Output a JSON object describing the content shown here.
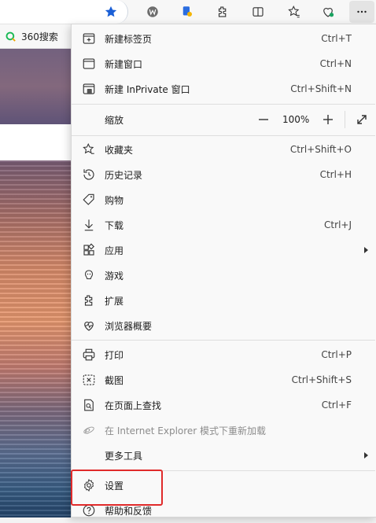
{
  "bookmarks": {
    "items": [
      {
        "label": "360搜索"
      }
    ]
  },
  "toolbar": {
    "icons": [
      "favorite-star-icon",
      "profile-w-icon",
      "extension-puzzle-icon",
      "split-screen-icon",
      "favorites-icon",
      "browser-health-icon",
      "more-icon"
    ]
  },
  "menu": {
    "items": [
      {
        "label": "新建标签页",
        "shortcut": "Ctrl+T"
      },
      {
        "label": "新建窗口",
        "shortcut": "Ctrl+N"
      },
      {
        "label": "新建 InPrivate 窗口",
        "shortcut": "Ctrl+Shift+N"
      },
      {
        "label": "缩放"
      },
      {
        "label": "收藏夹",
        "shortcut": "Ctrl+Shift+O"
      },
      {
        "label": "历史记录",
        "shortcut": "Ctrl+H"
      },
      {
        "label": "购物"
      },
      {
        "label": "下载",
        "shortcut": "Ctrl+J"
      },
      {
        "label": "应用"
      },
      {
        "label": "游戏"
      },
      {
        "label": "扩展"
      },
      {
        "label": "浏览器概要"
      },
      {
        "label": "打印",
        "shortcut": "Ctrl+P"
      },
      {
        "label": "截图",
        "shortcut": "Ctrl+Shift+S"
      },
      {
        "label": "在页面上查找",
        "shortcut": "Ctrl+F"
      },
      {
        "label": "在 Internet Explorer 模式下重新加载"
      },
      {
        "label": "更多工具"
      },
      {
        "label": "设置"
      },
      {
        "label": "帮助和反馈"
      }
    ],
    "zoom": {
      "value": "100%",
      "minus": "—",
      "plus": "+"
    }
  },
  "colors": {
    "highlight": "#e02a2a",
    "accent": "#1a73e8"
  }
}
